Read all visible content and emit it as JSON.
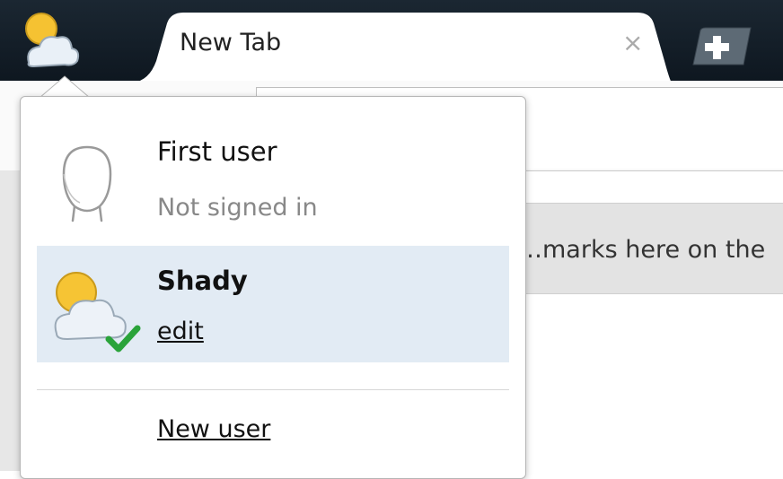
{
  "tab": {
    "title": "New Tab",
    "close_glyph": "×"
  },
  "toolbar": {
    "bookmark_hint": "…marks here on the"
  },
  "profile_menu": {
    "users": [
      {
        "name": "First user",
        "status": "Not signed in",
        "icon": "default-avatar-icon",
        "active": false
      },
      {
        "name": "Shady",
        "action_label": "edit",
        "icon": "sun-cloud-avatar-icon",
        "active": true
      }
    ],
    "new_user_label": "New user"
  },
  "colors": {
    "active_row": "#e2ebf4",
    "check": "#2aa33a",
    "frame": "#14202a"
  }
}
